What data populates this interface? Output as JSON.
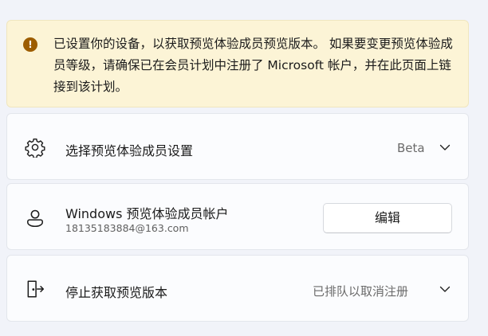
{
  "banner": {
    "icon": "warning-icon",
    "text": "已设置你的设备，以获取预览体验成员预览版本。 如果要变更预览体验成员等级，请确保已在会员计划中注册了 Microsoft 帐户，并在此页面上链接到该计划。"
  },
  "settings": [
    {
      "icon": "gear-icon",
      "title": "选择预览体验成员设置",
      "value": "Beta"
    },
    {
      "icon": "person-icon",
      "title": "Windows 预览体验成员帐户",
      "subtitle": "18135183884@163.com",
      "button_label": "编辑"
    },
    {
      "icon": "exit-icon",
      "title": "停止获取预览版本",
      "value": "已排队以取消注册"
    }
  ],
  "colors": {
    "banner_bg": "#fcf4d6",
    "warning_icon": "#9d5d00",
    "card_bg": "#fbfcfe",
    "page_bg": "#f1f3f9"
  }
}
